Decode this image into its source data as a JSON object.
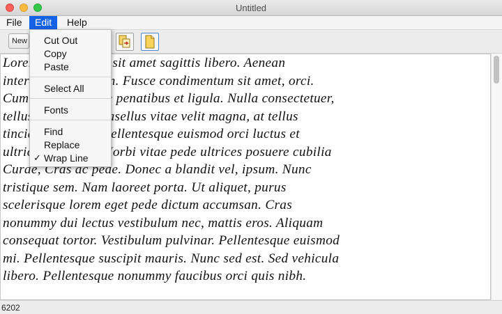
{
  "window": {
    "title": "Untitled"
  },
  "menubar": {
    "file": "File",
    "edit": "Edit",
    "help": "Help"
  },
  "toolbar": {
    "new_label": "New"
  },
  "edit_menu": {
    "cut": "Cut Out",
    "copy": "Copy",
    "paste": "Paste",
    "select_all": "Select All",
    "fonts": "Fonts",
    "find": "Find",
    "replace": "Replace",
    "wrap_line": "Wrap Line",
    "wrap_checked": "✓"
  },
  "editor": {
    "text": "Lorem ipsum dolor sit amet sagittis libero. Aenean\ninterdum fermentum. Fusce condimentum sit amet, orci.\nCum sociis natoque penatibus et ligula. Nulla consectetuer,\ntellus sit purus. Phasellus vitae velit magna, at tellus\ntincidunt tempus. Pellentesque euismod orci luctus et\nultrices fringilla. Morbi vitae pede ultrices posuere cubilia\nCurae, Cras ac pede. Donec a blandit vel, ipsum. Nunc\ntristique sem. Nam laoreet porta. Ut aliquet, purus\nscelerisque lorem eget pede dictum accumsan. Cras\nnonummy dui lectus vestibulum nec, mattis eros. Aliquam\nconsequat tortor. Vestibulum pulvinar. Pellentesque euismod\nmi. Pellentesque suscipit mauris. Nunc sed est. Sed vehicula\nlibero. Pellentesque nonummy faucibus orci quis nibh."
  },
  "status": {
    "char_count": "6202"
  }
}
